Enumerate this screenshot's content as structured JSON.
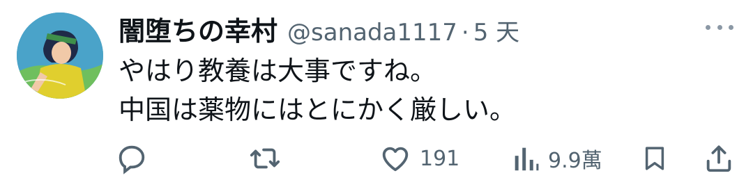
{
  "tweet": {
    "author_name": "闇堕ちの幸村",
    "handle": "@sanada1117",
    "separator": "·",
    "time": "5 天",
    "lines": [
      "やはり教養は大事ですね。",
      "中国は薬物にはとにかく厳しい。"
    ]
  },
  "actions": {
    "likes": "191",
    "views": "9.9萬"
  },
  "icons": {
    "more": "more-icon",
    "reply": "reply-icon",
    "retweet": "retweet-icon",
    "like": "heart-icon",
    "views": "views-icon",
    "bookmark": "bookmark-icon",
    "share": "share-icon"
  },
  "colors": {
    "text": "#0f1419",
    "muted": "#536471"
  }
}
